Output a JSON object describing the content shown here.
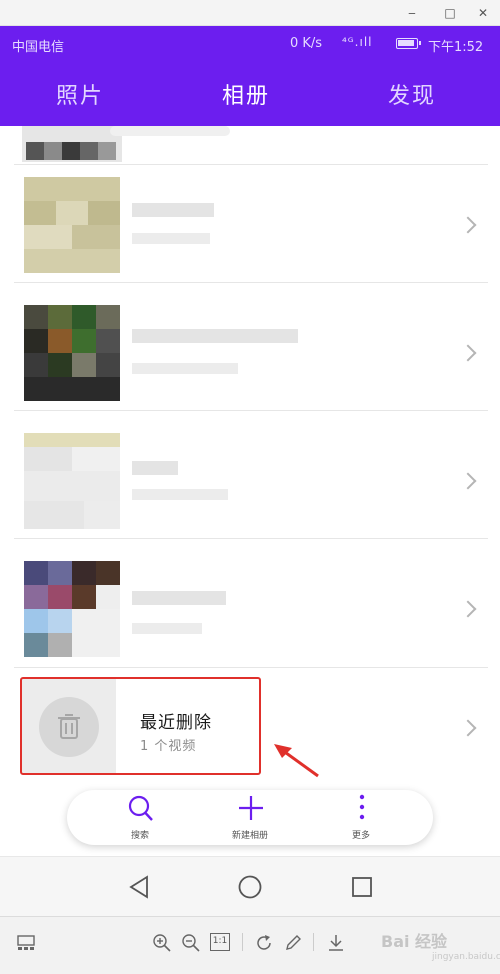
{
  "window": {
    "minimize": "‒",
    "maximize": "□",
    "close": "✕"
  },
  "status_bar": {
    "carrier": "中国电信",
    "net_speed": "0 K/s",
    "signal": "⁴ᴳ.ıll",
    "time": "下午1:52"
  },
  "tabs": [
    {
      "label": "照片",
      "active": false
    },
    {
      "label": "相册",
      "active": true
    },
    {
      "label": "发现",
      "active": false
    }
  ],
  "recently_deleted": {
    "title": "最近删除",
    "subtitle": "1 个视频"
  },
  "actions": [
    {
      "label": "搜索",
      "icon": "search-icon"
    },
    {
      "label": "新建相册",
      "icon": "plus-icon"
    },
    {
      "label": "更多",
      "icon": "more-vertical-icon"
    }
  ],
  "nav": {
    "back": "back-icon",
    "home": "home-icon",
    "recents": "recents-icon"
  },
  "viewer_toolbar": {
    "zoom_level_label": "1:1",
    "watermark": "Bai 经验",
    "watermark_sub": "jingyan.baidu.com"
  },
  "colors": {
    "accent": "#6c1eef",
    "highlight_box": "#e0302b"
  }
}
